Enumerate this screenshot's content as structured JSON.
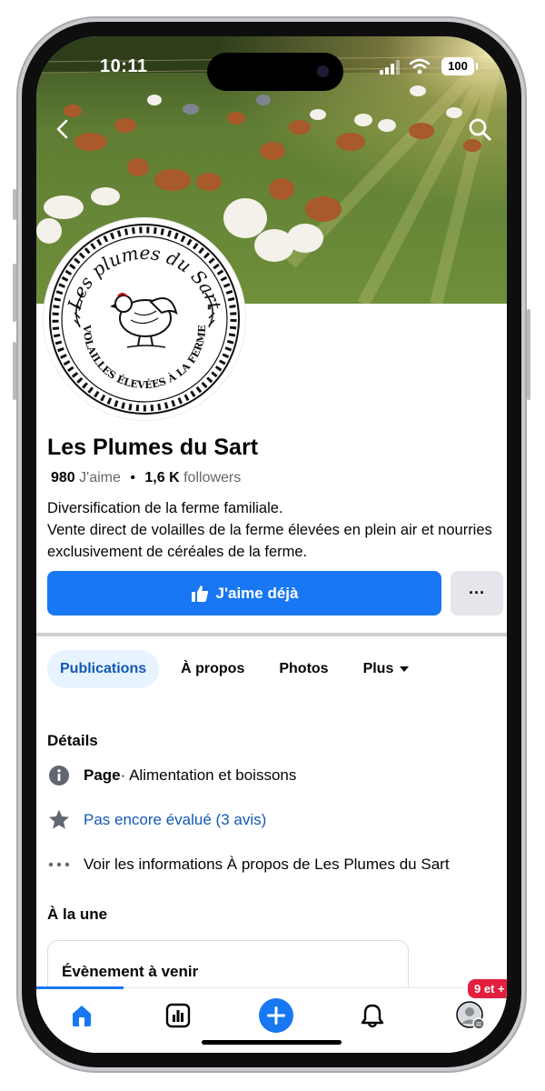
{
  "status_bar": {
    "time": "10:11",
    "battery": "100"
  },
  "page": {
    "name": "Les Plumes du Sart",
    "likes_count": "980",
    "likes_label": "J'aime",
    "followers_count": "1,6 K",
    "followers_label": "followers",
    "description_line1": "Diversification de la ferme familiale.",
    "description_line2": "Vente direct de volailles de la ferme élevées en plein air et nourries exclusivement de céréales de la ferme."
  },
  "logo": {
    "top_text": "Les plumes du Sart",
    "bottom_text": "VOLAILLES ÉLEVÉES À LA FERME"
  },
  "actions": {
    "like_button": "J'aime déjà",
    "more_button": "···"
  },
  "tabs": [
    {
      "label": "Publications",
      "active": true
    },
    {
      "label": "À propos"
    },
    {
      "label": "Photos"
    },
    {
      "label": "Plus"
    }
  ],
  "details": {
    "heading": "Détails",
    "category_bold": "Page",
    "category_text": " · Alimentation et boissons",
    "rating_text": "Pas encore évalué (3 avis)",
    "about_text": "Voir les informations À propos de Les Plumes du Sart"
  },
  "featured": {
    "heading": "À la une",
    "card_title": "Évènement à venir"
  },
  "bottom_nav": {
    "notification_badge": "9 et +"
  },
  "colors": {
    "accent": "#1877f2",
    "link": "#1458b4",
    "badge": "#e41e3f"
  }
}
